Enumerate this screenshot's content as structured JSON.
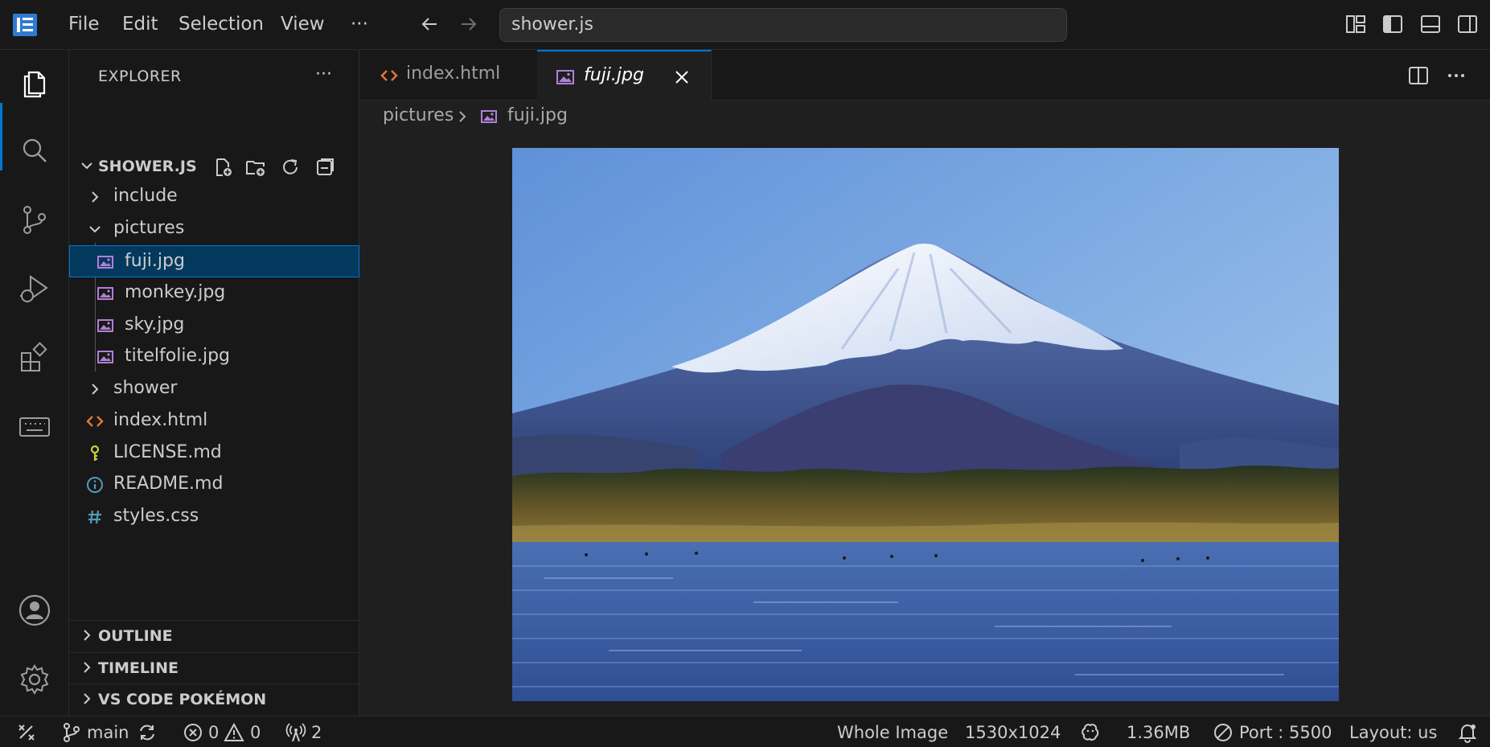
{
  "titlebar": {
    "menus": [
      "File",
      "Edit",
      "Selection",
      "View"
    ],
    "more": "···",
    "command_center": "shower.js"
  },
  "explorer": {
    "title": "EXPLORER",
    "more": "···",
    "root": "SHOWER.JS",
    "tree": [
      {
        "name": "include",
        "type": "folder",
        "expanded": false
      },
      {
        "name": "pictures",
        "type": "folder",
        "expanded": true
      },
      {
        "name": "fuji.jpg",
        "type": "image",
        "selected": true
      },
      {
        "name": "monkey.jpg",
        "type": "image"
      },
      {
        "name": "sky.jpg",
        "type": "image"
      },
      {
        "name": "titelfolie.jpg",
        "type": "image"
      },
      {
        "name": "shower",
        "type": "folder",
        "expanded": false
      },
      {
        "name": "index.html",
        "type": "html"
      },
      {
        "name": "LICENSE.md",
        "type": "license"
      },
      {
        "name": "README.md",
        "type": "info"
      },
      {
        "name": "styles.css",
        "type": "css"
      }
    ],
    "sections": [
      "OUTLINE",
      "TIMELINE",
      "VS CODE POKÉMON"
    ]
  },
  "editor": {
    "tabs": [
      {
        "label": "index.html",
        "active": false
      },
      {
        "label": "fuji.jpg",
        "active": true
      }
    ],
    "breadcrumb": [
      "pictures",
      "fuji.jpg"
    ]
  },
  "statusbar": {
    "branch": "main",
    "errors": "0",
    "warnings": "0",
    "ports": "2",
    "zoom": "Whole Image",
    "dimensions": "1530x1024",
    "size": "1.36MB",
    "port": "Port : 5500",
    "layout": "Layout: us"
  },
  "colors": {
    "accent": "#0078d4",
    "selected_bg": "#04395e",
    "image_icon": "#b180d7",
    "html_icon": "#e37933",
    "css_icon": "#519aba",
    "license_icon": "#cbcb41"
  }
}
